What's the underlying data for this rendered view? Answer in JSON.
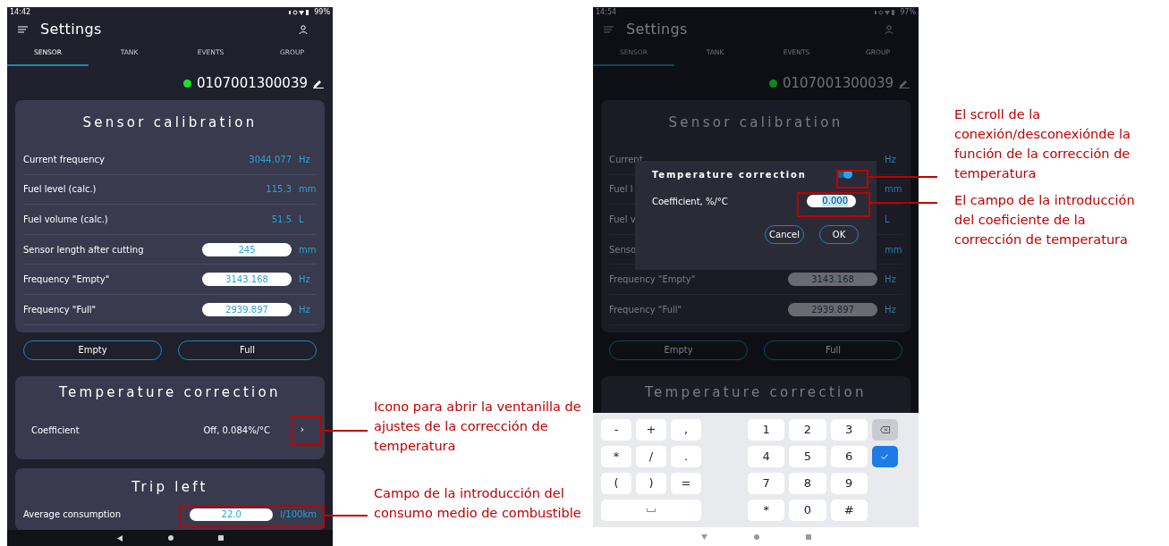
{
  "left_screen": {
    "status_time": "14:42",
    "status_battery": "99%",
    "title": "Settings",
    "tabs": [
      {
        "label": "SENSOR",
        "selected": true
      },
      {
        "label": "TANK",
        "selected": false
      },
      {
        "label": "EVENTS",
        "selected": false
      },
      {
        "label": "GROUP",
        "selected": false
      }
    ],
    "device": {
      "id": "0107001300039",
      "connected": true
    },
    "calibration": {
      "title": "Sensor calibration",
      "rows": [
        {
          "kind": "reading",
          "label": "Current frequency",
          "value": "3044.077",
          "unit": "Hz"
        },
        {
          "kind": "reading",
          "label": "Fuel level (calc.)",
          "value": "115.3",
          "unit": "mm"
        },
        {
          "kind": "reading",
          "label": "Fuel volume (calc.)",
          "value": "51.5",
          "unit": "L"
        },
        {
          "kind": "input",
          "label": "Sensor length after cutting",
          "value": "245",
          "unit": "mm"
        },
        {
          "kind": "input",
          "label": "Frequency \"Empty\"",
          "value": "3143.168",
          "unit": "Hz"
        },
        {
          "kind": "input",
          "label": "Frequency \"Full\"",
          "value": "2939.897",
          "unit": "Hz"
        }
      ]
    },
    "buttons": [
      "Empty",
      "Full"
    ],
    "temperature": {
      "title": "Temperature correction",
      "label": "Coefficient",
      "value": "Off, 0.084%/°C",
      "chevron": "›"
    },
    "trip": {
      "title": "Trip left",
      "label": "Average consumption",
      "value": "22.0",
      "unit": "l/100km"
    }
  },
  "right_screen": {
    "status_time": "14:54",
    "status_battery": "97%",
    "title": "Settings",
    "tabs": [
      {
        "label": "SENSOR",
        "selected": true
      },
      {
        "label": "TANK",
        "selected": false
      },
      {
        "label": "EVENTS",
        "selected": false
      },
      {
        "label": "GROUP",
        "selected": false
      }
    ],
    "device": {
      "id": "0107001300039",
      "connected": true
    },
    "calibration": {
      "title": "Sensor calibration",
      "rows": [
        {
          "kind": "reading",
          "label": "Current",
          "unit": "Hz"
        },
        {
          "kind": "reading",
          "label": "Fuel l",
          "unit": "mm"
        },
        {
          "kind": "reading",
          "label": "Fuel v",
          "unit": "L"
        },
        {
          "kind": "reading",
          "label": "Senso",
          "unit": "mm"
        },
        {
          "kind": "input",
          "label": "Frequency \"Empty\"",
          "value": "3143.168",
          "unit": "Hz"
        },
        {
          "kind": "input",
          "label": "Frequency \"Full\"",
          "value": "2939.897",
          "unit": "Hz"
        }
      ]
    },
    "buttons": [
      "Empty",
      "Full"
    ],
    "temperature": {
      "title": "Temperature correction"
    },
    "dialog": {
      "title": "Temperature correction",
      "toggle_on": true,
      "label": "Coefficient, %/°C",
      "value": "0.000",
      "buttons": [
        "Cancel",
        "OK"
      ]
    },
    "keyboard": {
      "left_keys": [
        "-",
        "+",
        ",",
        "*",
        "/",
        ".",
        "(",
        ")",
        "="
      ],
      "right_keys": [
        {
          "kind": "char",
          "label": "1"
        },
        {
          "kind": "char",
          "label": "2"
        },
        {
          "kind": "char",
          "label": "3"
        },
        {
          "kind": "backspace"
        },
        {
          "kind": "char",
          "label": "4"
        },
        {
          "kind": "char",
          "label": "5"
        },
        {
          "kind": "char",
          "label": "6"
        },
        {
          "kind": "enter"
        },
        {
          "kind": "char",
          "label": "7"
        },
        {
          "kind": "char",
          "label": "8"
        },
        {
          "kind": "char",
          "label": "9"
        },
        {
          "kind": "blank"
        },
        {
          "kind": "char",
          "label": "*"
        },
        {
          "kind": "char",
          "label": "0"
        },
        {
          "kind": "char",
          "label": "#"
        },
        {
          "kind": "blank"
        }
      ]
    }
  },
  "annotations_left": [
    "Icono para abrir la ventanilla de ajustes de la corrección de temperatura",
    "Campo de la introducción del consumo medio de combustible"
  ],
  "annotations_right": [
    "El scroll de la conexión/desconexiónde la función de la corrección de temperatura",
    "El campo de la introducción del coeficiente de la corrección de temperatura"
  ]
}
